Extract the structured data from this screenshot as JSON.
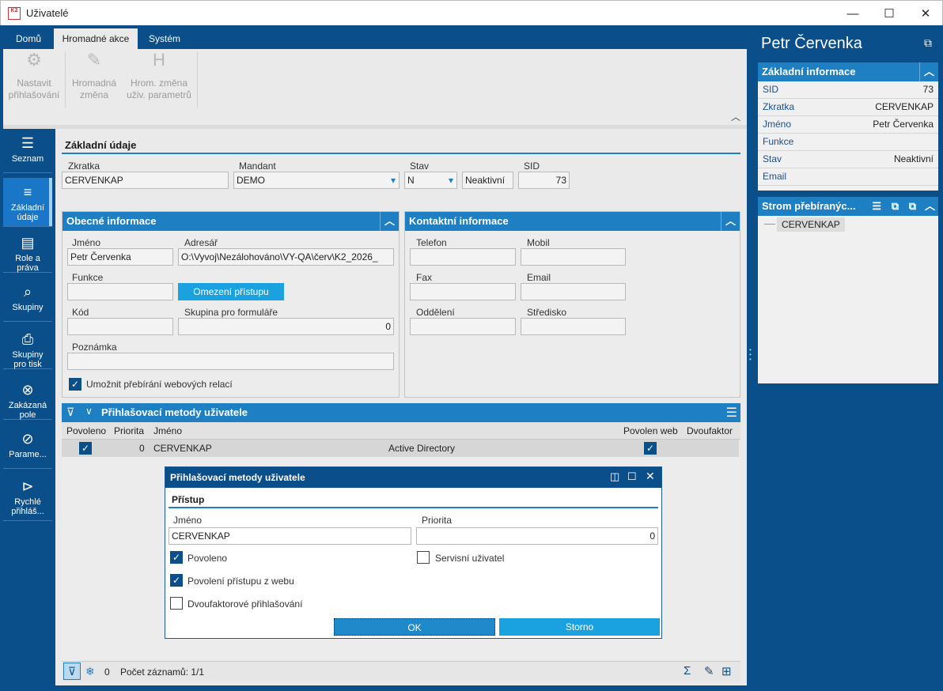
{
  "window": {
    "title": "Uživatelé",
    "logo_text": "K2"
  },
  "ribbon": {
    "tabs": [
      "Domů",
      "Hromadné akce",
      "Systém"
    ],
    "active_tab": "Hromadné akce",
    "buttons": [
      {
        "label": "Nastavit přihlašování",
        "line1": "Nastavit",
        "line2": "přihlašování",
        "icon": "login-settings-icon"
      },
      {
        "label": "Hromadná změna",
        "line1": "Hromadná",
        "line2": "změna",
        "icon": "pencil-icon"
      },
      {
        "label": "Hrom. změna uživ. parametrů",
        "line1": "Hrom. změna",
        "line2": "uživ. parametrů",
        "icon": "h-param-icon"
      }
    ]
  },
  "nav": {
    "items": [
      {
        "label1": "Seznam",
        "label2": "",
        "icon": "list-icon"
      },
      {
        "label1": "Základní",
        "label2": "údaje",
        "icon": "detail-list-icon"
      },
      {
        "label1": "Role a",
        "label2": "práva",
        "icon": "role-icon"
      },
      {
        "label1": "Skupiny",
        "label2": "",
        "icon": "group-icon"
      },
      {
        "label1": "Skupiny",
        "label2": "pro tisk",
        "icon": "print-group-icon"
      },
      {
        "label1": "Zakázaná",
        "label2": "pole",
        "icon": "forbidden-field-icon"
      },
      {
        "label1": "Parame...",
        "label2": "",
        "icon": "parameters-icon"
      },
      {
        "label1": "Rychlé",
        "label2": "přihláš...",
        "icon": "quick-login-icon"
      }
    ]
  },
  "basic": {
    "title": "Základní údaje",
    "zkratka_label": "Zkratka",
    "zkratka": "CERVENKAP",
    "mandant_label": "Mandant",
    "mandant": "DEMO",
    "stav_label": "Stav",
    "stav": "N",
    "stav_text": "Neaktivní",
    "sid_label": "SID",
    "sid": "73"
  },
  "general": {
    "title": "Obecné informace",
    "jmeno_label": "Jméno",
    "jmeno": "Petr Červenka",
    "adresar_label": "Adresář",
    "adresar": "O:\\Vyvoj\\Nezálohováno\\VY-QA\\červ\\K2_2026_",
    "funkce_label": "Funkce",
    "funkce": "",
    "omezeni_button": "Omezení přístupu",
    "kod_label": "Kód",
    "kod": "",
    "skupina_label": "Skupina pro formuláře",
    "skupina": "0",
    "poznamka_label": "Poznámka",
    "poznamka": "",
    "web_relace_label": "Umožnit přebírání webových relací",
    "web_relace": true
  },
  "contact": {
    "title": "Kontaktní informace",
    "telefon_label": "Telefon",
    "mobil_label": "Mobil",
    "fax_label": "Fax",
    "email_label": "Email",
    "oddeleni_label": "Oddělení",
    "stredisko_label": "Středisko"
  },
  "methods": {
    "title": "Přihlašovací metody uživatele",
    "columns": [
      "Povoleno",
      "Priorita",
      "Jméno",
      "",
      "Povolen web",
      "Dvoufaktor"
    ],
    "rows": [
      {
        "povoleno": true,
        "priorita": "0",
        "jmeno": "CERVENKAP",
        "typ": "Active Directory",
        "web": true,
        "dvoufaktor": ""
      }
    ]
  },
  "status": {
    "snow_count": "0",
    "records": "Počet záznamů: 1/1"
  },
  "right": {
    "name": "Petr Červenka",
    "info_title": "Základní informace",
    "info": [
      {
        "k": "SID",
        "v": "73"
      },
      {
        "k": "Zkratka",
        "v": "CERVENKAP"
      },
      {
        "k": "Jméno",
        "v": "Petr Červenka"
      },
      {
        "k": "Funkce",
        "v": ""
      },
      {
        "k": "Stav",
        "v": "Neaktivní"
      },
      {
        "k": "Email",
        "v": ""
      }
    ],
    "tree_title": "Strom přebíranýc...",
    "tree_item": "CERVENKAP"
  },
  "dialog": {
    "title": "Přihlašovací metody uživatele",
    "section": "Přístup",
    "jmeno_label": "Jméno",
    "jmeno": "CERVENKAP",
    "priorita_label": "Priorita",
    "priorita": "0",
    "povoleno_label": "Povoleno",
    "povoleno": true,
    "servisni_label": "Servisní uživatel",
    "servisni": false,
    "web_label": "Povolení přístupu z webu",
    "web": true,
    "dvouf_label": "Dvoufaktorové přihlašování",
    "dvouf": false,
    "ok": "OK",
    "storno": "Storno"
  },
  "colors": {
    "brand": "#0b4f8a",
    "accent": "#1e7fc3",
    "button": "#1aa1e0"
  }
}
